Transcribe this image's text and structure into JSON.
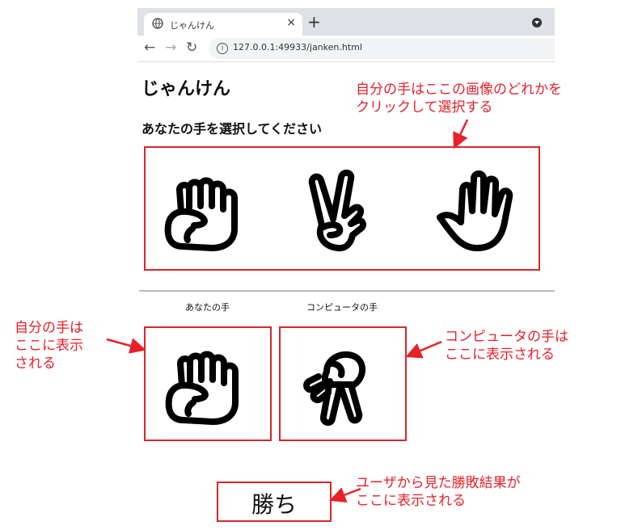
{
  "browser": {
    "tab_title": "じゃんけん",
    "url": "127.0.0.1:49933/janken.html",
    "close_glyph": "×",
    "newtab_glyph": "+",
    "back_glyph": "←",
    "forward_glyph": "→",
    "reload_glyph": "↻",
    "info_glyph": "i",
    "icons": [
      "globe-icon",
      "close-icon",
      "plus-icon",
      "back-arrow-icon",
      "forward-arrow-icon",
      "reload-icon",
      "info-icon",
      "chevron-down-icon"
    ]
  },
  "page": {
    "title": "じゃんけん",
    "instruction": "あなたの手を選択してください",
    "choices": [
      "rock-hand-icon",
      "scissors-hand-icon",
      "paper-hand-icon"
    ],
    "player_label": "あなたの手",
    "computer_label": "コンピュータの手",
    "player_hand": "rock-hand-icon",
    "computer_hand": "scissors-hand-icon",
    "result": "勝ち"
  },
  "annotations": {
    "choose": "自分の手はここの画像のどれかを\nクリックして選択する",
    "player": "自分の手は\nここに表示\nされる",
    "computer": "コンピュータの手は\nここに表示される",
    "result": "ユーザから見た勝敗結果が\nここに表示される"
  },
  "colors": {
    "annotation_red": "#e8202a",
    "box_red": "#d8262b",
    "tab_strip": "#dee1e6"
  }
}
